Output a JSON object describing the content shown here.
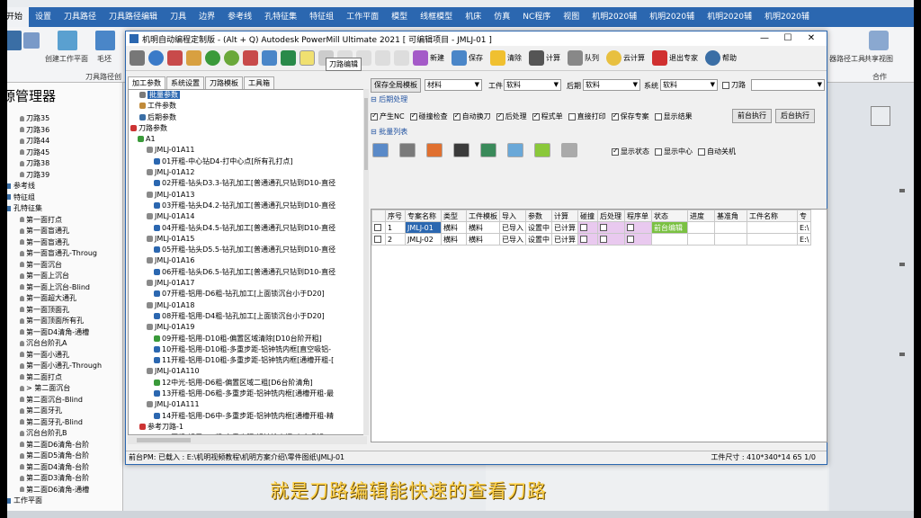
{
  "ribbon": {
    "tabs": [
      "开始",
      "设置",
      "刀具路径",
      "刀具路径编辑",
      "刀具",
      "边界",
      "参考线",
      "孔特征集",
      "特征组",
      "工作平面",
      "模型",
      "线框模型",
      "机床",
      "仿真",
      "NC程序",
      "视图",
      "机明2020辅",
      "机明2020辅",
      "机明2020辅",
      "机明2020辅"
    ],
    "active_tab": "开始",
    "groups": {
      "create_wp": "创建工作平面",
      "blank": "毛坯",
      "toolpath_group": "刀具路径创",
      "share_view": "共享视图",
      "cooperate": "合作",
      "other": "器路径工具"
    }
  },
  "left_panel": {
    "title": "源管理器",
    "items": [
      {
        "label": "刀路35",
        "level": 2
      },
      {
        "label": "刀路36",
        "level": 2
      },
      {
        "label": "刀路44",
        "level": 2
      },
      {
        "label": "刀路45",
        "level": 2
      },
      {
        "label": "刀路38",
        "level": 2
      },
      {
        "label": "刀路39",
        "level": 2
      },
      {
        "label": "参考线",
        "level": 1
      },
      {
        "label": "特征组",
        "level": 1
      },
      {
        "label": "孔特征集",
        "level": 1
      },
      {
        "label": "第一面打点",
        "level": 2
      },
      {
        "label": "第一面盲通孔",
        "level": 2
      },
      {
        "label": "第一面盲通孔",
        "level": 2
      },
      {
        "label": "第一面盲通孔-Throug",
        "level": 2
      },
      {
        "label": "第一面沉台",
        "level": 2
      },
      {
        "label": "第一面上沉台",
        "level": 2
      },
      {
        "label": "第一面上沉台-Blind",
        "level": 2
      },
      {
        "label": "第一面超大通孔",
        "level": 2
      },
      {
        "label": "第一面顶面孔",
        "level": 2
      },
      {
        "label": "第一面顶面所有孔",
        "level": 2
      },
      {
        "label": "第一面D4清角-通槽",
        "level": 2
      },
      {
        "label": "沉台台阶孔A",
        "level": 2
      },
      {
        "label": "第一面小通孔",
        "level": 2
      },
      {
        "label": "第一面小通孔-Through",
        "level": 2
      },
      {
        "label": "第二面打点",
        "level": 2
      },
      {
        "label": "> 第二面沉台",
        "level": 2
      },
      {
        "label": "第二面沉台-Blind",
        "level": 2
      },
      {
        "label": "第二面牙孔",
        "level": 2
      },
      {
        "label": "第二面牙孔-Blind",
        "level": 2
      },
      {
        "label": "沉台台阶孔B",
        "level": 2
      },
      {
        "label": "第二面D6清角-台阶",
        "level": 2
      },
      {
        "label": "第二面D5清角-台阶",
        "level": 2
      },
      {
        "label": "第二面D4清角-台阶",
        "level": 2
      },
      {
        "label": "第二面D3清角-台阶",
        "level": 2
      },
      {
        "label": "第二面D6清角-通槽",
        "level": 2
      },
      {
        "label": "工作平面",
        "level": 1
      }
    ]
  },
  "dialog": {
    "title": "机明自动编程定制版 - (Alt + Q) Autodesk PowerMill Ultimate 2021   [ 可编辑项目 - JMLJ-01 ]",
    "toolbar": {
      "new": "新建",
      "save": "保存",
      "clear": "清除",
      "calc": "计算",
      "queue": "队列",
      "cloud": "云计算",
      "exit_expert": "退出专家",
      "help": "帮助"
    },
    "tooltip": "刀路编辑",
    "left_tabs": [
      "加工参数",
      "系统设置",
      "刀路模板",
      "工具箱"
    ],
    "tree": [
      {
        "label": "批量参数",
        "indent": 12,
        "icon": "#7a7a7a",
        "selected": true
      },
      {
        "label": "工件参数",
        "indent": 12,
        "icon": "#c08a3a"
      },
      {
        "label": "后期参数",
        "indent": 12,
        "icon": "#3a6ea5"
      },
      {
        "label": "刀路参数",
        "indent": 2,
        "icon": "#c33"
      },
      {
        "label": "A1",
        "indent": 10,
        "icon": "#3a9a3a"
      },
      {
        "label": "JMLJ-01A11",
        "indent": 20,
        "icon": "#8a8a8a"
      },
      {
        "label": "01开粗-中心钻D4-打中心点[所有孔打点]",
        "indent": 28,
        "icon": "#2b67b0"
      },
      {
        "label": "JMLJ-01A12",
        "indent": 20,
        "icon": "#8a8a8a"
      },
      {
        "label": "02开粗-钻头D3.3-钻孔加工[普通通孔只钻到D10-直径",
        "indent": 28,
        "icon": "#2b67b0"
      },
      {
        "label": "JMLJ-01A13",
        "indent": 20,
        "icon": "#8a8a8a"
      },
      {
        "label": "03开粗-钻头D4.2-钻孔加工[普通通孔只钻到D10-直径",
        "indent": 28,
        "icon": "#2b67b0"
      },
      {
        "label": "JMLJ-01A14",
        "indent": 20,
        "icon": "#8a8a8a"
      },
      {
        "label": "04开粗-钻头D4.5-钻孔加工[普通通孔只钻到D10-直径",
        "indent": 28,
        "icon": "#2b67b0"
      },
      {
        "label": "JMLJ-01A15",
        "indent": 20,
        "icon": "#8a8a8a"
      },
      {
        "label": "05开粗-钻头D5.5-钻孔加工[普通通孔只钻到D10-直径",
        "indent": 28,
        "icon": "#2b67b0"
      },
      {
        "label": "JMLJ-01A16",
        "indent": 20,
        "icon": "#8a8a8a"
      },
      {
        "label": "06开粗-钻头D6.5-钻孔加工[普通通孔只钻到D10-直径",
        "indent": 28,
        "icon": "#2b67b0"
      },
      {
        "label": "JMLJ-01A17",
        "indent": 20,
        "icon": "#8a8a8a"
      },
      {
        "label": "07开粗-铝用-D6粗-钻孔加工[上面锁沉台小于D20]",
        "indent": 28,
        "icon": "#2b67b0"
      },
      {
        "label": "JMLJ-01A18",
        "indent": 20,
        "icon": "#8a8a8a"
      },
      {
        "label": "08开粗-铝用-D4粗-钻孔加工[上面锁沉台小于D20]",
        "indent": 28,
        "icon": "#2b67b0"
      },
      {
        "label": "JMLJ-01A19",
        "indent": 20,
        "icon": "#8a8a8a"
      },
      {
        "label": "09开粗-铝用-D10粗-偏置区域清除[D10台阶开粗]",
        "indent": 28,
        "icon": "#3a9a3a"
      },
      {
        "label": "10开粗-铝用-D10粗-多重步距-铝钟铣内框[直空吸铝-",
        "indent": 28,
        "icon": "#2b67b0"
      },
      {
        "label": "11开粗-铝用-D10粗-多重步距-铝钟铣内框[通槽开粗-[",
        "indent": 28,
        "icon": "#2b67b0"
      },
      {
        "label": "JMLJ-01A110",
        "indent": 20,
        "icon": "#8a8a8a"
      },
      {
        "label": "12中光-铝用-D6粗-偏置区域二粗[D6台阶清角]",
        "indent": 28,
        "icon": "#3a9a3a"
      },
      {
        "label": "13开粗-铝用-D6粗-多重步距-铝钟铣内框[通槽开粗-最",
        "indent": 28,
        "icon": "#2b67b0"
      },
      {
        "label": "JMLJ-01A111",
        "indent": 20,
        "icon": "#8a8a8a"
      },
      {
        "label": "14开粗-铝用-D6中-多重步距-铝钟铣内框[通槽开粗-精",
        "indent": 28,
        "icon": "#2b67b0"
      },
      {
        "label": "参考刀路-1",
        "indent": 12,
        "icon": "#c33"
      },
      {
        "label": "15开粗-铝用-D6粗-多重步距-铝钟铣内框[直空吸铝...",
        "indent": 28,
        "icon": "#2b67b0"
      }
    ],
    "right": {
      "save_global_template": "保存全局模板",
      "material_label": "材料",
      "material_value": "",
      "workpiece_label": "工件",
      "workpiece_value": "软料",
      "post_label": "后期",
      "post_value": "软料",
      "system_label": "系统",
      "system_value": "软料",
      "tool_label": "刀路",
      "post_process_section": "后期处理",
      "options": [
        {
          "label": "产生NC",
          "on": true
        },
        {
          "label": "碰撞检查",
          "on": true
        },
        {
          "label": "自动换刀",
          "on": true
        },
        {
          "label": "后处理",
          "on": true
        },
        {
          "label": "程式单",
          "on": true
        },
        {
          "label": "直接打印",
          "on": false
        },
        {
          "label": "保存专案",
          "on": true
        },
        {
          "label": "显示结果",
          "on": false
        }
      ],
      "pre_exec": "前台执行",
      "bg_exec": "后台执行",
      "batch_section": "批量列表",
      "list_options": [
        {
          "label": "显示状态",
          "on": true
        },
        {
          "label": "显示中心",
          "on": false
        },
        {
          "label": "自动关机",
          "on": false
        }
      ],
      "columns": [
        "",
        "序号",
        "专案名称",
        "类型",
        "工件模板",
        "导入",
        "参数",
        "计算",
        "碰撞",
        "后处理",
        "程序单",
        "状态",
        "进度",
        "基准角",
        "工件名称",
        "专"
      ],
      "rows": [
        [
          "",
          "1",
          "JMLJ-01",
          "横料",
          "横料",
          "已导入",
          "设置中",
          "已计算",
          "",
          "",
          "",
          "前台编辑",
          "",
          "",
          "",
          "E:\\"
        ],
        [
          "",
          "2",
          "JMLJ-02",
          "横料",
          "横料",
          "已导入",
          "设置中",
          "已计算",
          "",
          "",
          "",
          "",
          "",
          "",
          "",
          "E:\\"
        ]
      ]
    },
    "status": "前台PM: 已载入 : E:\\机明视频教程\\机明方案介绍\\零件图纸\\JMLJ-01",
    "status_right": "工件尺寸 :   410*340*14   65 1/0"
  },
  "subtitle": "就是刀路编辑能快速的查看刀路",
  "colors": {
    "accent": "#2b67b0",
    "highlight_pink": "#e9c9ef",
    "status_green": "#7ac142",
    "subtitle": "#ffd24a"
  }
}
